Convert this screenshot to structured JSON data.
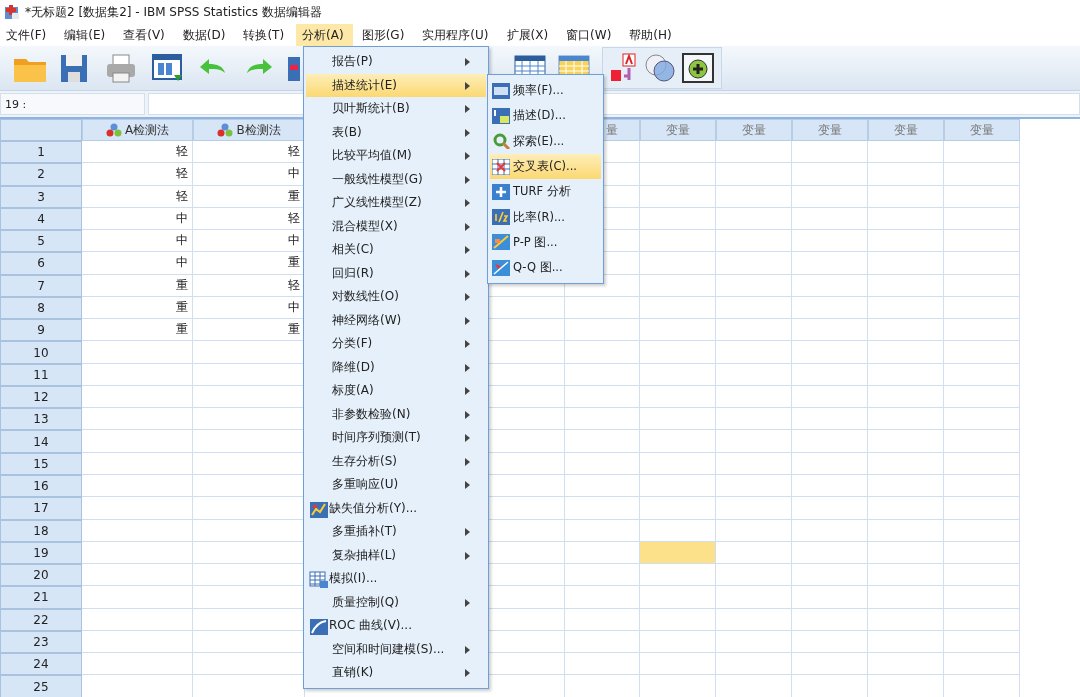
{
  "window": {
    "title": "*无标题2 [数据集2] - IBM SPSS Statistics 数据编辑器"
  },
  "menu_bar": [
    {
      "label": "文件(F)",
      "selected": false
    },
    {
      "label": "编辑(E)",
      "selected": false
    },
    {
      "label": "查看(V)",
      "selected": false
    },
    {
      "label": "数据(D)",
      "selected": false
    },
    {
      "label": "转换(T)",
      "selected": false
    },
    {
      "label": "分析(A)",
      "selected": true
    },
    {
      "label": "图形(G)",
      "selected": false
    },
    {
      "label": "实用程序(U)",
      "selected": false
    },
    {
      "label": "扩展(X)",
      "selected": false
    },
    {
      "label": "窗口(W)",
      "selected": false
    },
    {
      "label": "帮助(H)",
      "selected": false
    }
  ],
  "cell_editor": {
    "cell": "19 :"
  },
  "grid": {
    "columns": [
      {
        "kind": "nominal",
        "label": "A检测法",
        "selected": false
      },
      {
        "kind": "nominal",
        "label": "B检测法",
        "selected": false
      },
      {
        "kind": "partial",
        "label": "量",
        "selected": false
      },
      {
        "kind": "variable",
        "label": "变量",
        "selected": true
      },
      {
        "kind": "variable",
        "label": "变量",
        "selected": false
      },
      {
        "kind": "variable",
        "label": "变量",
        "selected": false
      },
      {
        "kind": "variable",
        "label": "变量",
        "selected": false
      },
      {
        "kind": "variable",
        "label": "变量",
        "selected": false
      }
    ],
    "rows": [
      {
        "number": "1",
        "cells": [
          "轻",
          "轻"
        ],
        "selected": false
      },
      {
        "number": "2",
        "cells": [
          "轻",
          "中"
        ],
        "selected": false
      },
      {
        "number": "3",
        "cells": [
          "轻",
          "重"
        ],
        "selected": false
      },
      {
        "number": "4",
        "cells": [
          "中",
          "轻"
        ],
        "selected": false
      },
      {
        "number": "5",
        "cells": [
          "中",
          "中"
        ],
        "selected": false
      },
      {
        "number": "6",
        "cells": [
          "中",
          "重"
        ],
        "selected": false
      },
      {
        "number": "7",
        "cells": [
          "重",
          "轻"
        ],
        "selected": false
      },
      {
        "number": "8",
        "cells": [
          "重",
          "中"
        ],
        "selected": false
      },
      {
        "number": "9",
        "cells": [
          "重",
          "重"
        ],
        "selected": false
      },
      {
        "number": "10",
        "selected": false
      },
      {
        "number": "11",
        "selected": false
      },
      {
        "number": "12",
        "selected": false
      },
      {
        "number": "13",
        "selected": false
      },
      {
        "number": "14",
        "selected": false
      },
      {
        "number": "15",
        "selected": false
      },
      {
        "number": "16",
        "selected": false
      },
      {
        "number": "17",
        "selected": false
      },
      {
        "number": "18",
        "selected": false
      },
      {
        "number": "19",
        "selected": true
      },
      {
        "number": "20",
        "selected": false
      },
      {
        "number": "21",
        "selected": false
      },
      {
        "number": "22",
        "selected": false
      },
      {
        "number": "23",
        "selected": false
      },
      {
        "number": "24",
        "selected": false
      },
      {
        "number": "25",
        "selected": false
      }
    ]
  },
  "analyze_menu": {
    "items": [
      {
        "label": "报告(P)",
        "kind": "submenu",
        "selected": false
      },
      {
        "label": "描述统计(E)",
        "kind": "submenu",
        "selected": true
      },
      {
        "label": "贝叶斯统计(B)",
        "kind": "submenu",
        "selected": false
      },
      {
        "label": "表(B)",
        "kind": "submenu",
        "selected": false
      },
      {
        "label": "比较平均值(M)",
        "kind": "submenu",
        "selected": false
      },
      {
        "label": "一般线性模型(G)",
        "kind": "submenu",
        "selected": false
      },
      {
        "label": "广义线性模型(Z)",
        "kind": "submenu",
        "selected": false
      },
      {
        "label": "混合模型(X)",
        "kind": "submenu",
        "selected": false
      },
      {
        "label": "相关(C)",
        "kind": "submenu",
        "selected": false
      },
      {
        "label": "回归(R)",
        "kind": "submenu",
        "selected": false
      },
      {
        "label": "对数线性(O)",
        "kind": "submenu",
        "selected": false
      },
      {
        "label": "神经网络(W)",
        "kind": "submenu",
        "selected": false
      },
      {
        "label": "分类(F)",
        "kind": "submenu",
        "selected": false
      },
      {
        "label": "降维(D)",
        "kind": "submenu",
        "selected": false
      },
      {
        "label": "标度(A)",
        "kind": "submenu",
        "selected": false
      },
      {
        "label": "非参数检验(N)",
        "kind": "submenu",
        "selected": false
      },
      {
        "label": "时间序列预测(T)",
        "kind": "submenu",
        "selected": false
      },
      {
        "label": "生存分析(S)",
        "kind": "submenu",
        "selected": false
      },
      {
        "label": "多重响应(U)",
        "kind": "submenu",
        "selected": false
      },
      {
        "label": "缺失值分析(Y)...",
        "kind": "command",
        "selected": false
      },
      {
        "label": "多重插补(T)",
        "kind": "submenu",
        "selected": false
      },
      {
        "label": "复杂抽样(L)",
        "kind": "submenu",
        "selected": false
      },
      {
        "label": "模拟(I)...",
        "kind": "command",
        "selected": false
      },
      {
        "label": "质量控制(Q)",
        "kind": "submenu",
        "selected": false
      },
      {
        "label": "ROC 曲线(V)...",
        "kind": "command",
        "selected": false
      },
      {
        "label": "空间和时间建模(S)...",
        "kind": "submenu",
        "selected": false
      },
      {
        "label": "直销(K)",
        "kind": "submenu",
        "selected": false
      }
    ]
  },
  "descriptives_submenu": {
    "items": [
      {
        "label": "频率(F)...",
        "selected": false
      },
      {
        "label": "描述(D)...",
        "selected": false
      },
      {
        "label": "探索(E)...",
        "selected": false
      },
      {
        "label": "交叉表(C)...",
        "selected": true
      },
      {
        "label": "TURF 分析",
        "selected": false
      },
      {
        "label": "比率(R)...",
        "selected": false
      },
      {
        "label": "P-P 图...",
        "selected": false
      },
      {
        "label": "Q-Q 图...",
        "selected": false
      }
    ]
  }
}
